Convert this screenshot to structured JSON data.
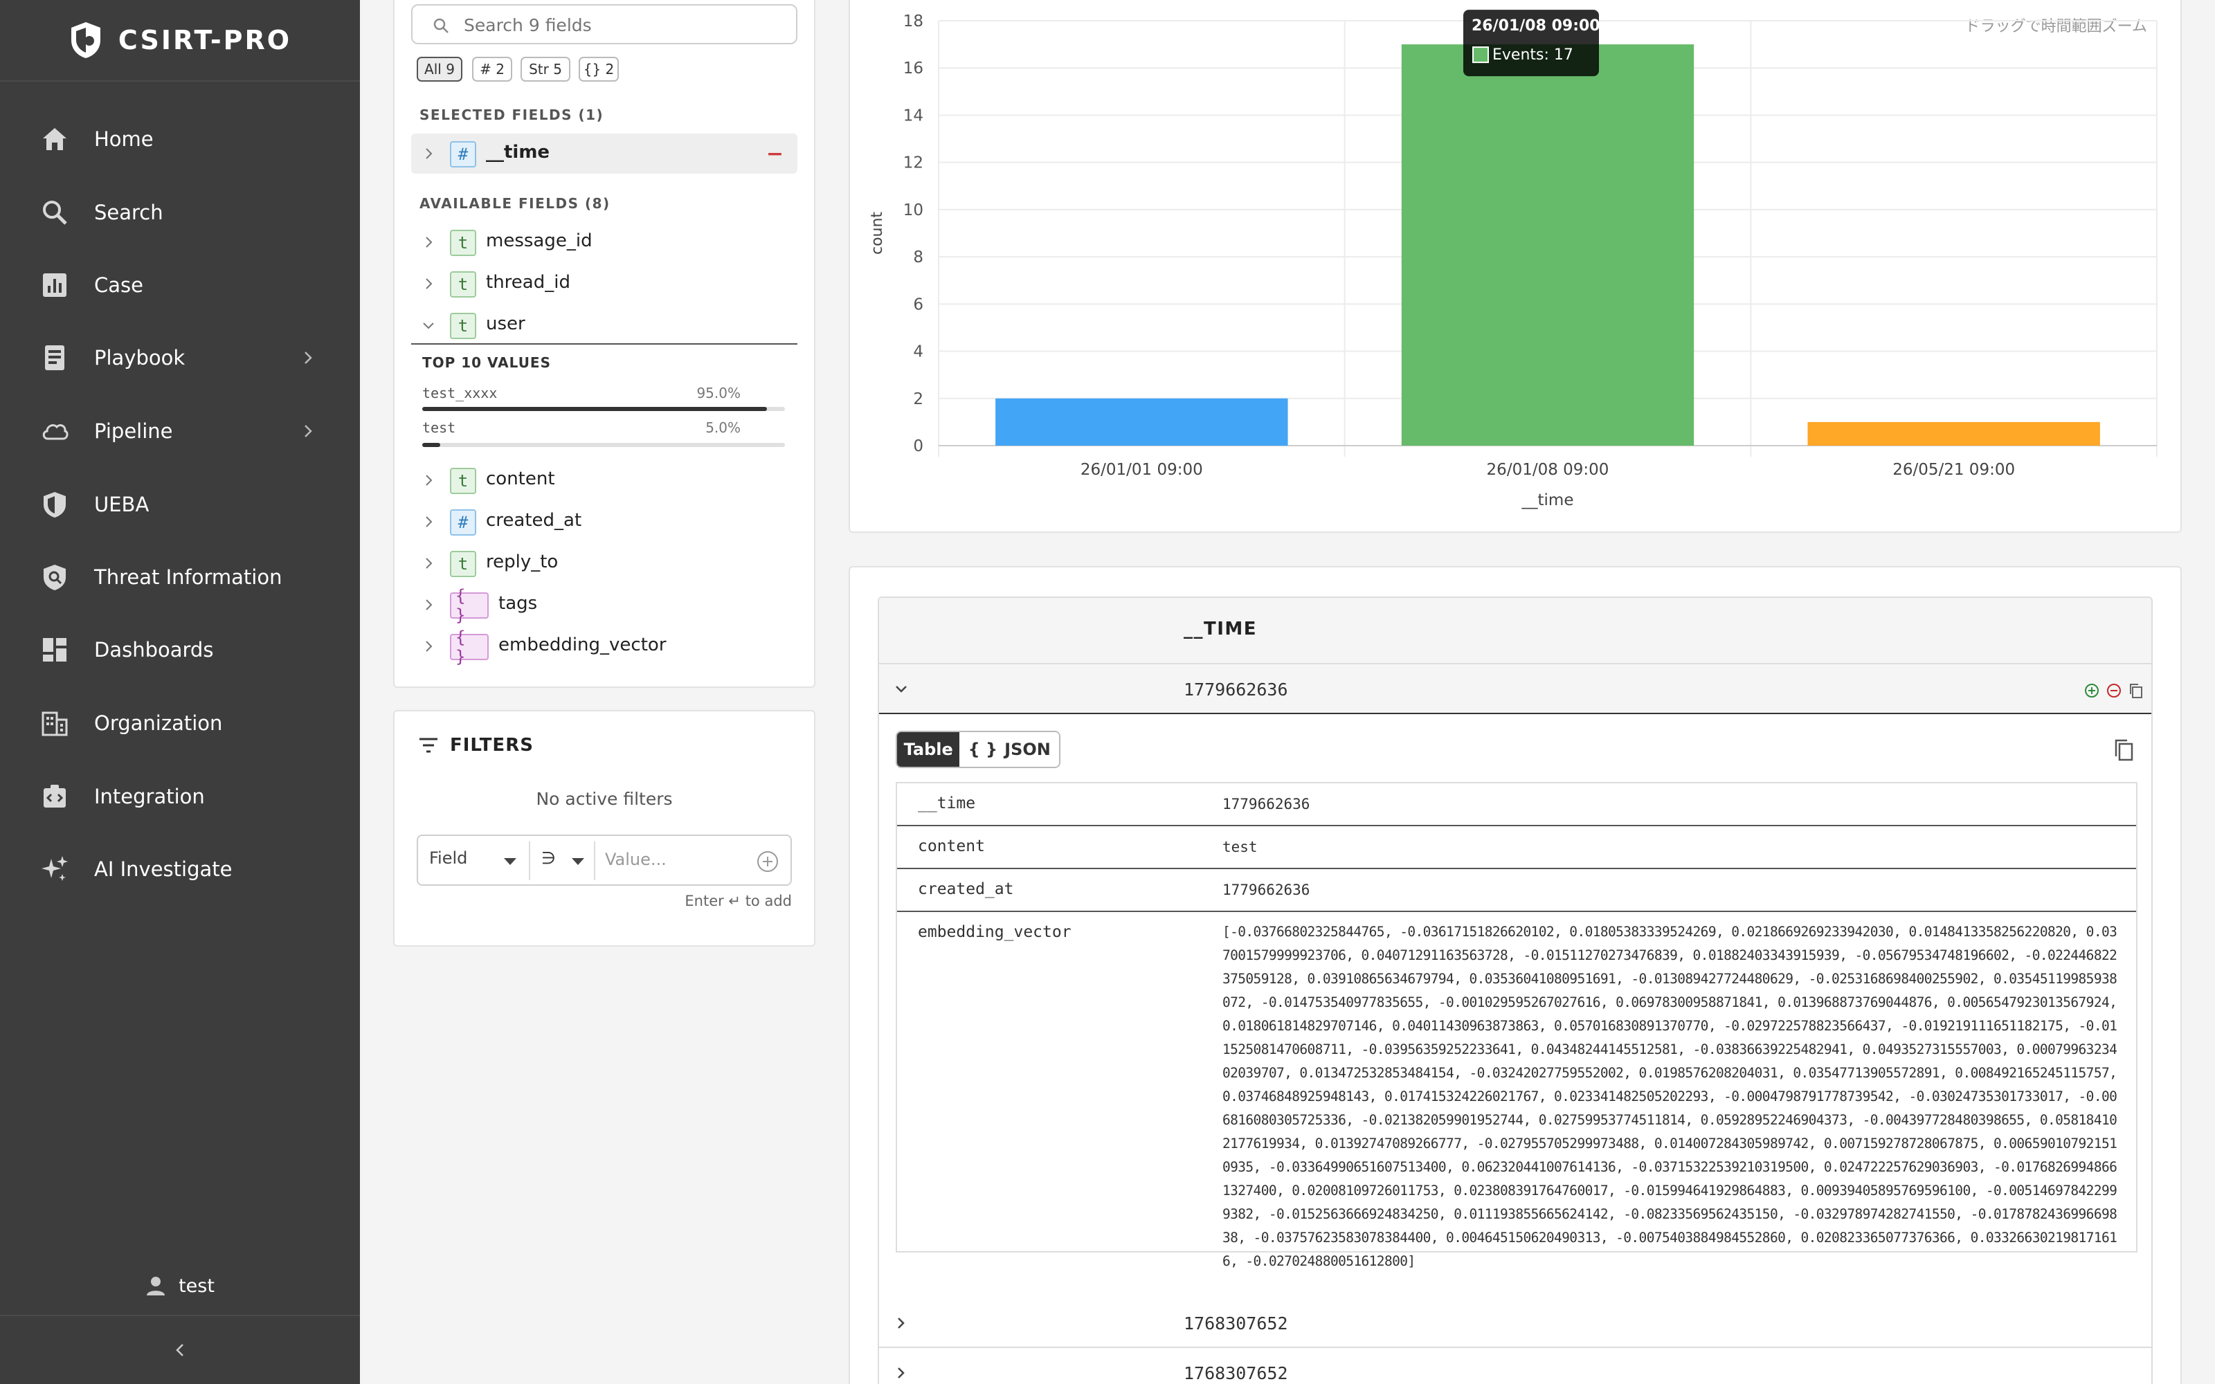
{
  "app": {
    "brand": "CSIRT-PRO"
  },
  "sidebar": {
    "items": [
      {
        "label": "Home",
        "icon": "home-icon"
      },
      {
        "label": "Search",
        "icon": "search-icon"
      },
      {
        "label": "Case",
        "icon": "case-chart-icon"
      },
      {
        "label": "Playbook",
        "icon": "playbook-icon",
        "has_submenu": true
      },
      {
        "label": "Pipeline",
        "icon": "cloud-icon",
        "has_submenu": true
      },
      {
        "label": "UEBA",
        "icon": "shield-icon"
      },
      {
        "label": "Threat Information",
        "icon": "threat-shield-icon"
      },
      {
        "label": "Dashboards",
        "icon": "dashboard-icon"
      },
      {
        "label": "Organization",
        "icon": "building-icon"
      },
      {
        "label": "Integration",
        "icon": "integration-icon"
      },
      {
        "label": "AI Investigate",
        "icon": "sparkle-icon"
      }
    ],
    "user": "test"
  },
  "fields": {
    "search_placeholder": "Search 9 fields",
    "chips": [
      "All 9",
      "# 2",
      "Str 5",
      "{} 2"
    ],
    "selected_heading": "SELECTED FIELDS (1)",
    "selected": [
      {
        "name": "__time",
        "type": "#"
      }
    ],
    "available_heading": "AVAILABLE FIELDS (8)",
    "available": [
      {
        "name": "message_id",
        "type": "t"
      },
      {
        "name": "thread_id",
        "type": "t"
      },
      {
        "name": "user",
        "type": "t",
        "expanded": true
      },
      {
        "name": "content",
        "type": "t"
      },
      {
        "name": "created_at",
        "type": "#"
      },
      {
        "name": "reply_to",
        "type": "t"
      },
      {
        "name": "tags",
        "type": "{ }"
      },
      {
        "name": "embedding_vector",
        "type": "{ }"
      }
    ],
    "top_values_heading": "TOP 10 VALUES",
    "top_values": [
      {
        "value": "test_xxxx",
        "pct_label": "95.0%",
        "fraction": 0.95
      },
      {
        "value": "test",
        "pct_label": "5.0%",
        "fraction": 0.05
      }
    ]
  },
  "filters": {
    "title": "FILTERS",
    "empty_text": "No active filters",
    "field_placeholder": "Field",
    "operator": "∋",
    "value_placeholder": "Value...",
    "hint": "Enter ↵ to add"
  },
  "chart_data": {
    "type": "bar",
    "categories": [
      "26/01/01 09:00",
      "26/01/08 09:00",
      "26/05/21 09:00"
    ],
    "values": [
      2,
      17,
      1
    ],
    "colors": [
      "#42a5f5",
      "#66bb6a",
      "#ffa726"
    ],
    "xlabel": "__time",
    "ylabel": "count",
    "ylim": [
      0,
      18
    ],
    "yticks": [
      0,
      2,
      4,
      6,
      8,
      10,
      12,
      14,
      16,
      18
    ],
    "grid": true,
    "zoom_hint": "ドラッグで時間範囲ズーム",
    "tooltip": {
      "title": "26/01/08 09:00",
      "label": "Events: 17",
      "index": 1
    }
  },
  "results": {
    "column": "__TIME",
    "rows": [
      "1779662636",
      "1768307652",
      "1768307652"
    ],
    "view_tabs": {
      "table": "Table",
      "json": "JSON"
    },
    "detail": [
      {
        "key": "__time",
        "value": "1779662636"
      },
      {
        "key": "content",
        "value": "test"
      },
      {
        "key": "created_at",
        "value": "1779662636"
      },
      {
        "key": "embedding_vector",
        "value": "[-0.03766802325844765, -0.03617151826620102, 0.01805383339524269, 0.0218669269233942030, 0.0148413358256220820, 0.037001579999923706, 0.04071291163563728, -0.01511270273476839, 0.01882403343915939, -0.05679534748196602, -0.022446822375059128, 0.03910865634679794, 0.03536041080951691, -0.013089427724480629, -0.0253168698400255902, 0.03545119985938072, -0.014753540977835655, -0.001029595267027616, 0.06978300958871841, 0.013968873769044876, 0.0056547923013567924, 0.018061814829707146, 0.04011430963873863, 0.057016830891370770, -0.029722578823566437, -0.019219111651182175, -0.011525081470608711, -0.03956359252233641, 0.04348244145512581, -0.03836639225482941, 0.0493527315557003, 0.0007996323402039707, 0.013472532853484154, -0.03242027759552002, 0.0198576208204031, 0.03547713905572891, 0.008492165245115757, 0.03746848925948143, 0.017415324226021767, 0.023341482505202293, -0.0004798791778739542, -0.03024735301733017, -0.006816080305725336, -0.021382059901952744, 0.02759953774511814, 0.05928952246904373, -0.004397728480398655, 0.058184102177619934, 0.01392747089266777, -0.027955705299973488, 0.014007284305989742, 0.007159278728067875, 0.006590107921510935, -0.03364990651607513400, 0.062320441007614136, -0.03715322539210319500, 0.024722257629036903, -0.01768269948661327400, 0.02008109726011753, 0.023808391764760017, -0.015994641929864883, 0.00939405895769596100, -0.005146978422999382, -0.0152563666924834250, 0.011193855665624142, -0.08233569562435150, -0.032978974282741550, -0.017878243699669838, -0.03757623583078384400, 0.004645150620490313, -0.0075403884984552860, 0.020823365077376366, 0.033266302198171616, -0.027024880051612800]"
      }
    ]
  }
}
